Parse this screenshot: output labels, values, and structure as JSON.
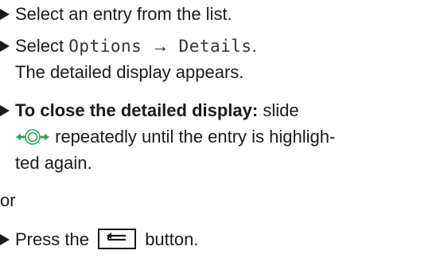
{
  "steps": [
    {
      "text": "Select an entry from the list."
    },
    {
      "prefix": "Select",
      "menu_a": "Options",
      "arrow": "→",
      "menu_b": "Details",
      "suffix": ".",
      "result": "The detailed display appears."
    },
    {
      "bold": "To close the detailed display:",
      "text_a": "slide",
      "text_b": "repeatedly until the entry is highligh-",
      "text_c": "ted again."
    }
  ],
  "or_label": "or",
  "step_press": {
    "prefix": "Press the",
    "suffix": "button."
  },
  "icons": {
    "controller": "controller-slide-left-right-icon",
    "back_button": "back-button-icon"
  },
  "colors": {
    "text": "#1a1a1a",
    "controller_arrows": "#2fa84f"
  }
}
